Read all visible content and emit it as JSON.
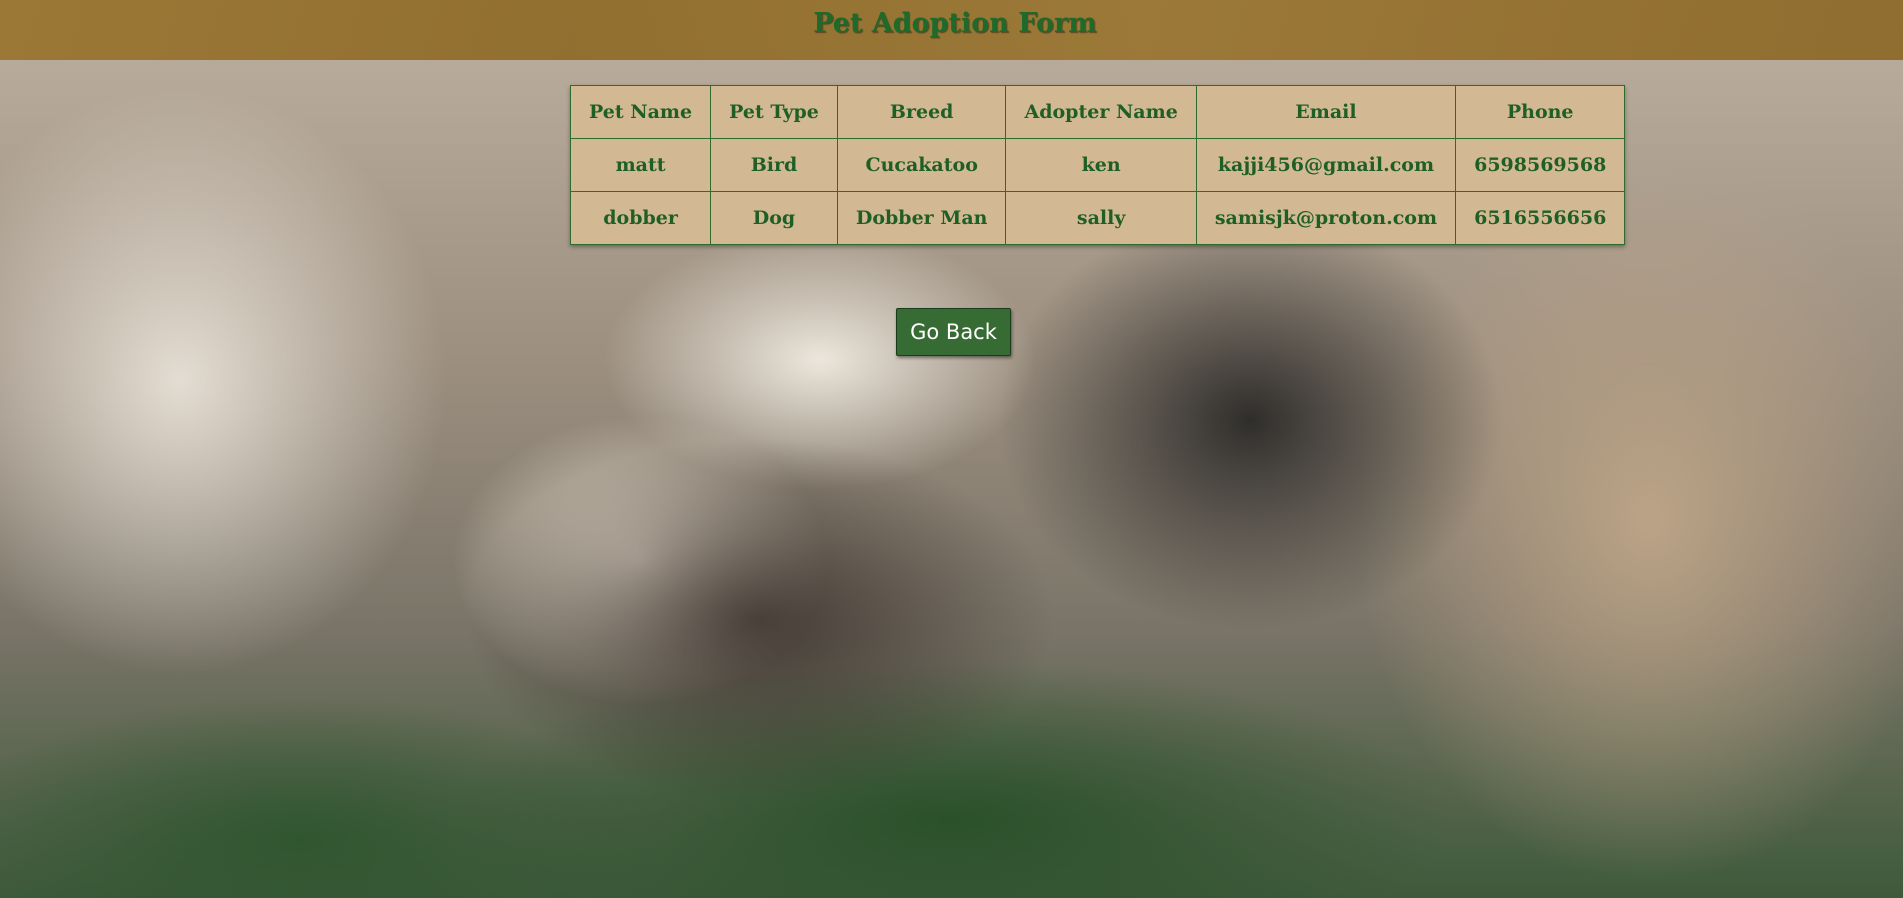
{
  "header": {
    "title": "Pet Adoption Form"
  },
  "table": {
    "columns": [
      "Pet Name",
      "Pet Type",
      "Breed",
      "Adopter Name",
      "Email",
      "Phone"
    ],
    "rows": [
      [
        "matt",
        "Bird",
        "Cucakatoo",
        "ken",
        "kajji456@gmail.com",
        "6598569568"
      ],
      [
        "dobber",
        "Dog",
        "Dobber Man",
        "sally",
        "samisjk@proton.com",
        "6516556656"
      ]
    ]
  },
  "actions": {
    "back_label": "Go Back"
  },
  "colors": {
    "header_bg": "#9a7530",
    "title_text": "#1f6a2a",
    "table_bg": "#d2b993",
    "table_text": "#1f5f26",
    "button_bg": "#376b34"
  }
}
